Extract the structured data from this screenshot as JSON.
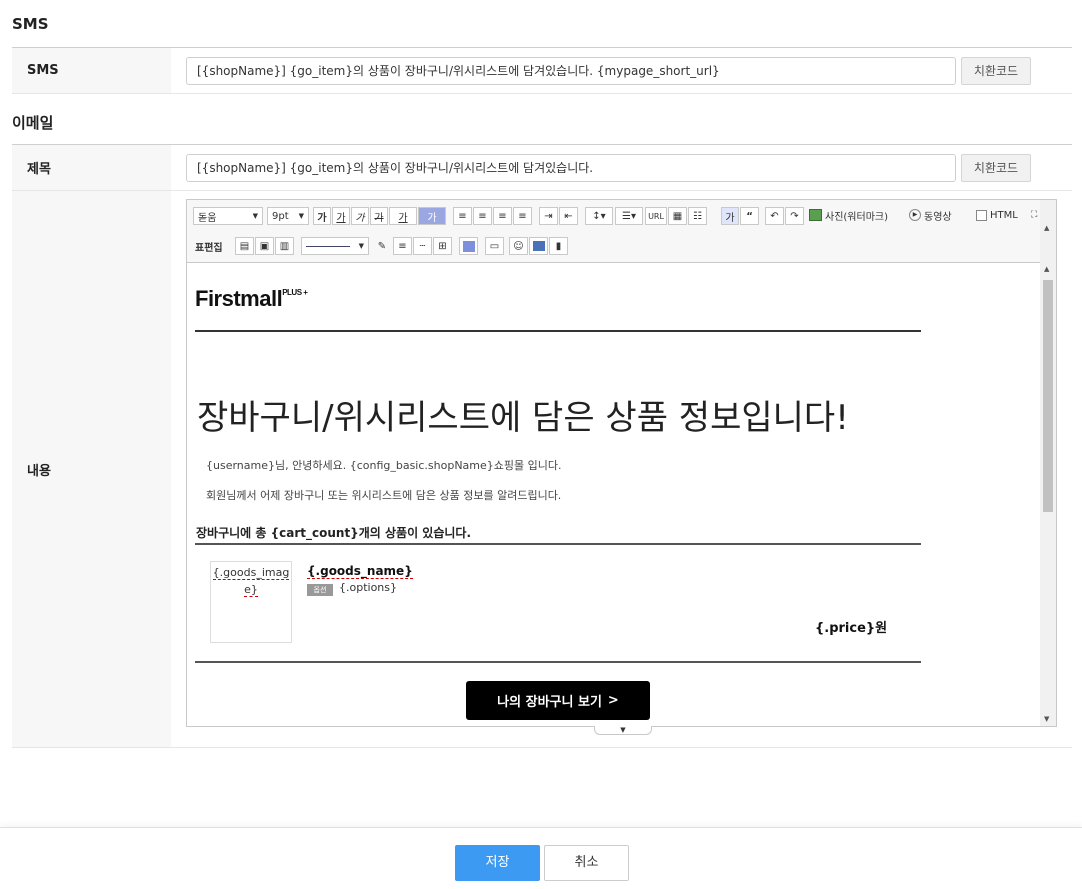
{
  "sms_section": {
    "title": "SMS",
    "row_label": "SMS",
    "message": "[{shopName}] {go_item}의 상품이 장바구니/위시리스트에 담겨있습니다. {mypage_short_url}",
    "replace_button": "치환코드"
  },
  "email_section": {
    "title": "이메일",
    "subject_label": "제목",
    "subject": "[{shopName}] {go_item}의 상품이 장바구니/위시리스트에 담겨있습니다.",
    "replace_button": "치환코드",
    "content_label": "내용"
  },
  "editor": {
    "toolbar": {
      "font_select": "돋움",
      "size_select": "9pt",
      "bold": "가",
      "underline": "가",
      "italic": "가",
      "strike": "가",
      "font_color": "가",
      "bg_color": "가",
      "url": "URL",
      "korean_tool": "가",
      "photo": "사진(워터마크)",
      "video": "동영상",
      "html": "HTML",
      "table_edit_label": "표편집"
    },
    "content": {
      "logo_text": "Firstmall",
      "logo_sup": "PLUS +",
      "headline": "장바구니/위시리스트에 담은 상품 정보입니다!",
      "greeting": "{username}님, 안녕하세요. {config_basic.shopName}쇼핑몰 입니다.",
      "notice": "회원님께서 어제 장바구니 또는 위시리스트에 담은 상품 정보를 알려드립니다.",
      "cart_title": "장바구니에 총 {cart_count}개의 상품이 있습니다.",
      "goods_image_line1": "{.goods_imag",
      "goods_image_line2": "e}",
      "goods_name": "{.goods_name}",
      "option_badge": "옵션",
      "options": "{.options}",
      "price": "{.price}원",
      "cta": "나의 장바구니 보기"
    }
  },
  "footer": {
    "save": "저장",
    "cancel": "취소"
  },
  "colors": {
    "primary": "#3d9af2",
    "label_bg": "#f7f7f7",
    "cta_bg": "#000000"
  }
}
